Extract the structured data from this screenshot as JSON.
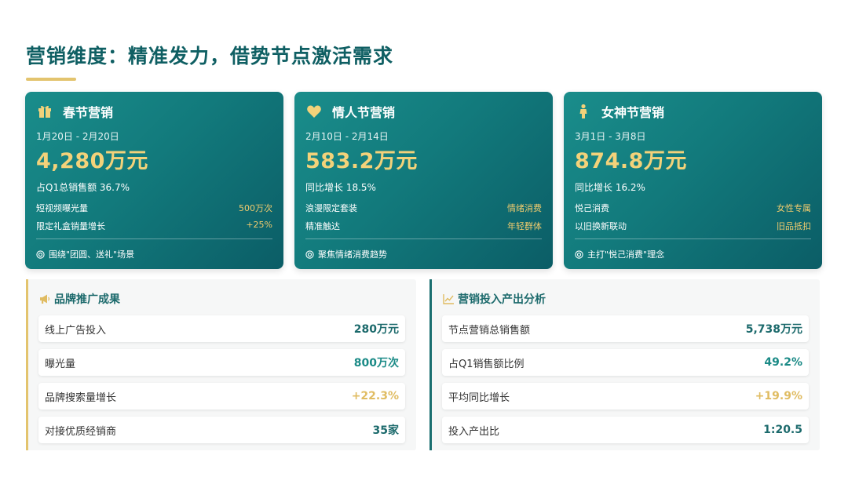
{
  "title": "营销维度：精准发力，借势节点激活需求",
  "cards": [
    {
      "icon": "gift-icon",
      "label": "春节营销",
      "date": "1月20日 - 2月20日",
      "amount": "4,280万元",
      "share": "占Q1总销售额 36.7%",
      "rows": [
        {
          "key": "短视频曝光量",
          "value": "500万次"
        },
        {
          "key": "限定礼盒销量增长",
          "value": "+25%"
        }
      ],
      "foot": "围绕\"团圆、送礼\"场景"
    },
    {
      "icon": "heart-icon",
      "label": "情人节营销",
      "date": "2月10日 - 2月14日",
      "amount": "583.2万元",
      "share": "同比增长 18.5%",
      "rows": [
        {
          "key": "浪漫限定套装",
          "value": "情绪消费"
        },
        {
          "key": "精准触达",
          "value": "年轻群体"
        }
      ],
      "foot": "聚焦情绪消费趋势"
    },
    {
      "icon": "female-icon",
      "label": "女神节营销",
      "date": "3月1日 - 3月8日",
      "amount": "874.8万元",
      "share": "同比增长 16.2%",
      "rows": [
        {
          "key": "悦己消费",
          "value": "女性专属"
        },
        {
          "key": "以旧换新联动",
          "value": "旧品抵扣"
        }
      ],
      "foot": "主打\"悦己消费\"理念"
    }
  ],
  "brand_panel": {
    "icon": "megaphone-icon",
    "title": "品牌推广成果",
    "rows": [
      {
        "key": "线上广告投入",
        "value": "280万元",
        "color": "#1c6a6c"
      },
      {
        "key": "曝光量",
        "value": "800万次",
        "color": "#1a8a86"
      },
      {
        "key": "品牌搜索量增长",
        "value": "+22.3%",
        "color": "#e0bc62"
      },
      {
        "key": "对接优质经销商",
        "value": "35家",
        "color": "#1c6a6c"
      }
    ]
  },
  "roi_panel": {
    "icon": "line-chart-icon",
    "title": "营销投入产出分析",
    "rows": [
      {
        "key": "节点营销总销售额",
        "value": "5,738万元",
        "color": "#1c6a6c"
      },
      {
        "key": "占Q1销售额比例",
        "value": "49.2%",
        "color": "#1a8a86"
      },
      {
        "key": "平均同比增长",
        "value": "+19.9%",
        "color": "#e0bc62"
      },
      {
        "key": "投入产出比",
        "value": "1:20.5",
        "color": "#1c6a6c"
      }
    ]
  },
  "colors": {
    "teal_dark": "#0f5f63",
    "teal": "#1a8d8b",
    "gold": "#e3c46e",
    "accent_gold_text": "#f3d27a"
  }
}
